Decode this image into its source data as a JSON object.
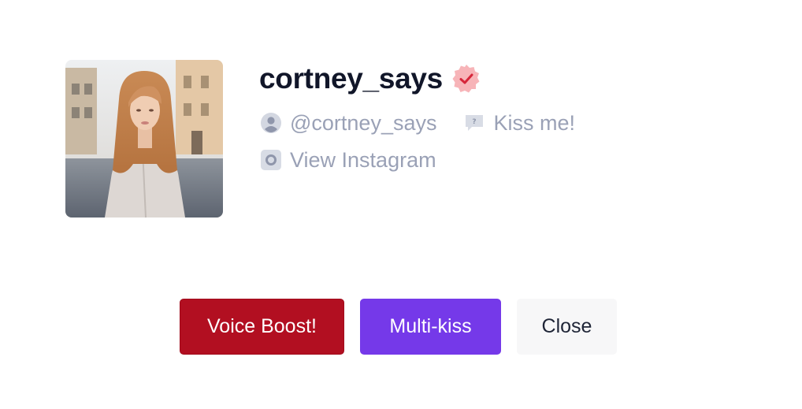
{
  "profile": {
    "username": "cortney_says",
    "handle": "@cortney_says",
    "status": "Kiss me!",
    "instagram_link": "View Instagram",
    "verified": true
  },
  "icons": {
    "verified": "verified-badge-icon",
    "user": "user-icon",
    "message": "speech-bubble-icon",
    "instagram": "instagram-icon"
  },
  "actions": {
    "boost_label": "Voice Boost!",
    "multikiss_label": "Multi-kiss",
    "close_label": "Close"
  },
  "colors": {
    "boost": "#b20f21",
    "multikiss": "#7539e9",
    "close_bg": "#f7f7f8",
    "username": "#111629",
    "meta": "#9aa1b6",
    "verified_badge": "#f7b4b8",
    "verified_check": "#d6263a"
  }
}
